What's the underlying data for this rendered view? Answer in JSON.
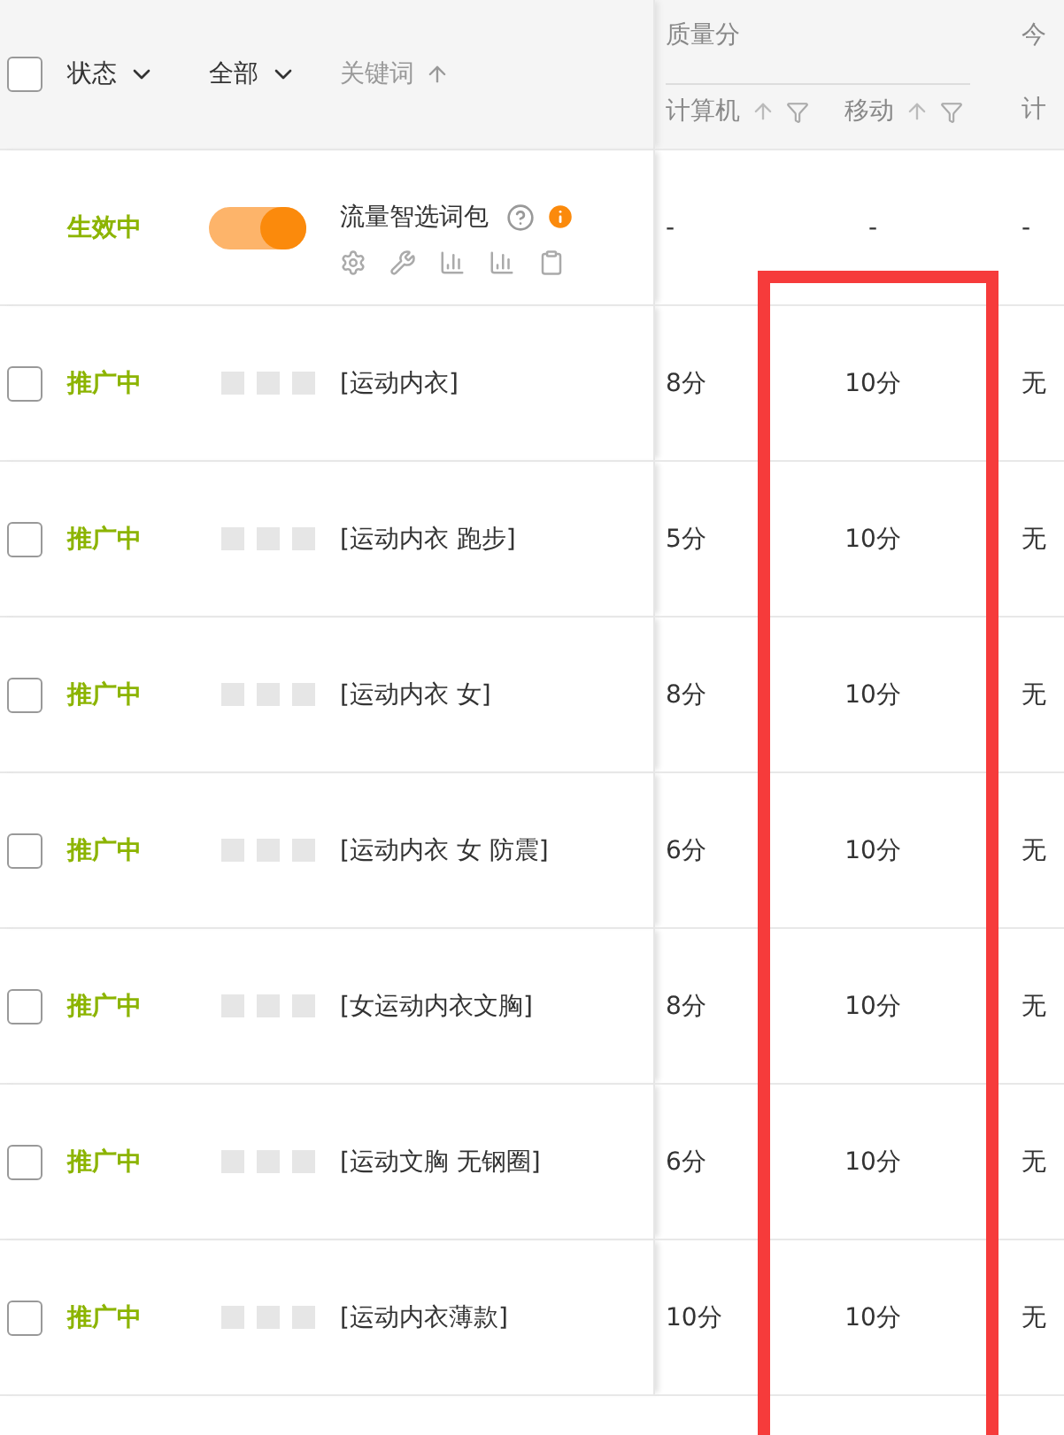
{
  "header": {
    "checked": false,
    "status_filter": "状态",
    "scope_filter": "全部",
    "keyword": "关键词",
    "quality_group": "质量分",
    "quality_columns": [
      "计算机",
      "移动"
    ],
    "next_group": "今",
    "next_sub": "计"
  },
  "package_row": {
    "status": "生效中",
    "on": true,
    "name": "流量智选词包",
    "values": [
      "-",
      "-",
      "-"
    ]
  },
  "rows": [
    {
      "checked": false,
      "status": "推广中",
      "keyword": "[运动内衣]",
      "pc": "8分",
      "mobile": "10分",
      "col3": "无"
    },
    {
      "checked": false,
      "status": "推广中",
      "keyword": "[运动内衣 跑步]",
      "pc": "5分",
      "mobile": "10分",
      "col3": "无"
    },
    {
      "checked": false,
      "status": "推广中",
      "keyword": "[运动内衣 女]",
      "pc": "8分",
      "mobile": "10分",
      "col3": "无"
    },
    {
      "checked": false,
      "status": "推广中",
      "keyword": "[运动内衣 女 防震]",
      "pc": "6分",
      "mobile": "10分",
      "col3": "无"
    },
    {
      "checked": false,
      "status": "推广中",
      "keyword": "[女运动内衣文胸]",
      "pc": "8分",
      "mobile": "10分",
      "col3": "无"
    },
    {
      "checked": false,
      "status": "推广中",
      "keyword": "[运动文胸 无钢圈]",
      "pc": "6分",
      "mobile": "10分",
      "col3": "无"
    },
    {
      "checked": false,
      "status": "推广中",
      "keyword": "[运动内衣薄款]",
      "pc": "10分",
      "mobile": "10分",
      "col3": "无"
    }
  ],
  "highlight_frame": true
}
